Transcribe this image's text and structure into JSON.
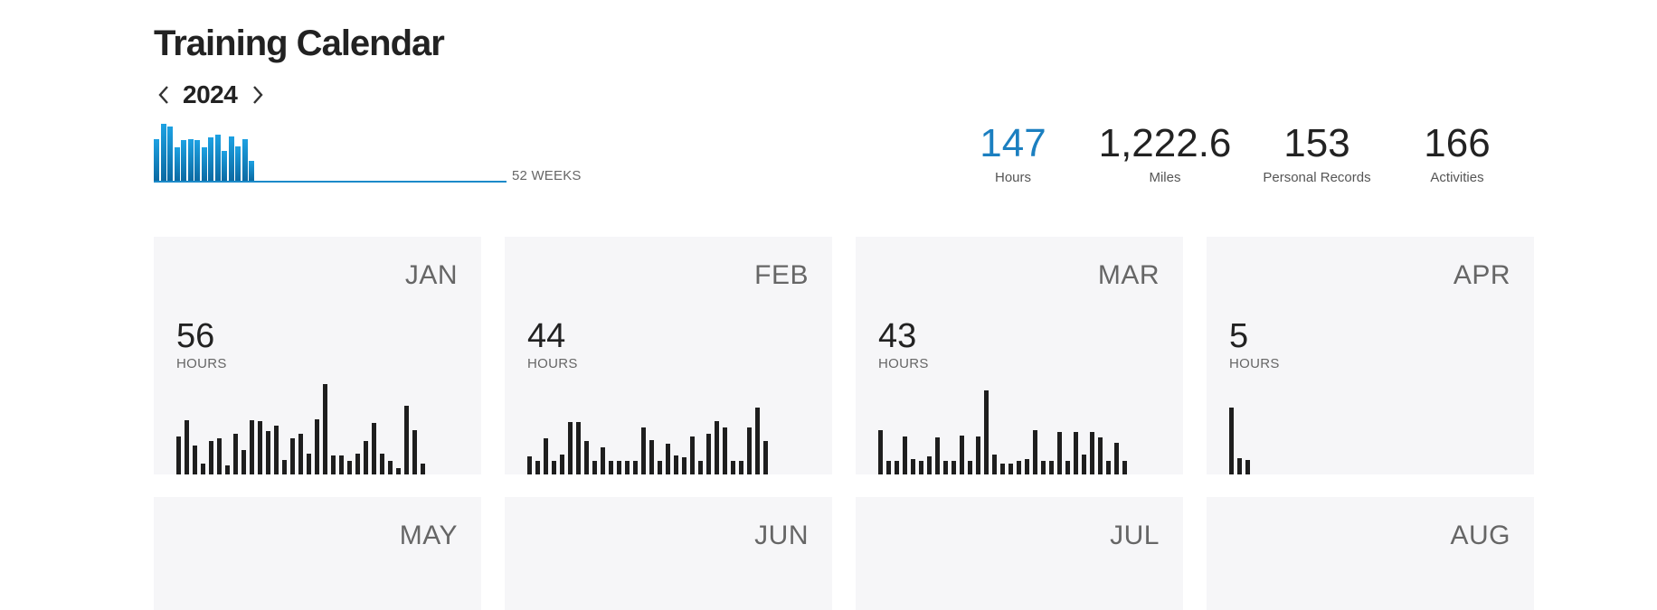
{
  "page": {
    "title": "Training Calendar"
  },
  "year_nav": {
    "year": "2024",
    "prev_icon": "chevron-left-icon",
    "next_icon": "chevron-right-icon"
  },
  "weekly_chart": {
    "weeks_label": "52 WEEKS",
    "total_weeks": 52,
    "values": [
      0.72,
      0.98,
      0.93,
      0.58,
      0.7,
      0.72,
      0.7,
      0.58,
      0.75,
      0.8,
      0.52,
      0.76,
      0.6,
      0.72,
      0.34
    ],
    "color_top": "#1da1e2",
    "color_bottom": "#0b6aa3"
  },
  "stats": {
    "hours": {
      "value": "147",
      "label": "Hours"
    },
    "miles": {
      "value": "1,222.6",
      "label": "Miles"
    },
    "prs": {
      "value": "153",
      "label": "Personal Records"
    },
    "activities": {
      "value": "166",
      "label": "Activities"
    }
  },
  "months": [
    {
      "name": "JAN",
      "hours": "56",
      "unit": "HOURS",
      "daily": [
        0.42,
        0.6,
        0.32,
        0.12,
        0.37,
        0.4,
        0.1,
        0.45,
        0.27,
        0.6,
        0.59,
        0.48,
        0.54,
        0.16,
        0.4,
        0.45,
        0.23,
        0.61,
        1.0,
        0.21,
        0.21,
        0.15,
        0.23,
        0.37,
        0.57,
        0.23,
        0.15,
        0.07,
        0.76,
        0.49,
        0.12
      ]
    },
    {
      "name": "FEB",
      "hours": "44",
      "unit": "HOURS",
      "daily": [
        0.2,
        0.15,
        0.4,
        0.15,
        0.22,
        0.58,
        0.58,
        0.37,
        0.15,
        0.3,
        0.15,
        0.15,
        0.15,
        0.15,
        0.52,
        0.38,
        0.15,
        0.34,
        0.21,
        0.19,
        0.42,
        0.15,
        0.45,
        0.59,
        0.52,
        0.15,
        0.15,
        0.52,
        0.74,
        0.37
      ]
    },
    {
      "name": "MAR",
      "hours": "43",
      "unit": "HOURS",
      "daily": [
        0.49,
        0.15,
        0.15,
        0.42,
        0.17,
        0.15,
        0.2,
        0.41,
        0.15,
        0.15,
        0.43,
        0.15,
        0.42,
        0.93,
        0.22,
        0.12,
        0.12,
        0.15,
        0.17,
        0.49,
        0.15,
        0.15,
        0.47,
        0.15,
        0.47,
        0.22,
        0.47,
        0.41,
        0.15,
        0.35,
        0.15
      ]
    },
    {
      "name": "APR",
      "hours": "5",
      "unit": "HOURS",
      "daily": [
        0.74,
        0.18,
        0.16
      ]
    },
    {
      "name": "MAY",
      "hours": "",
      "unit": "",
      "daily": []
    },
    {
      "name": "JUN",
      "hours": "",
      "unit": "",
      "daily": []
    },
    {
      "name": "JUL",
      "hours": "",
      "unit": "",
      "daily": []
    },
    {
      "name": "AUG",
      "hours": "",
      "unit": "",
      "daily": []
    }
  ]
}
